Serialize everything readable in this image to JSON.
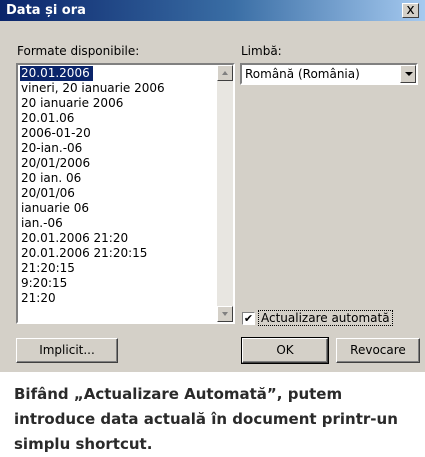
{
  "dialog": {
    "title": "Data și ora",
    "close_glyph": "x",
    "formats_label": "Formate disponibile:",
    "language_label": "Limbă:",
    "formats": [
      "20.01.2006",
      "vineri, 20 ianuarie 2006",
      "20 ianuarie 2006",
      "20.01.06",
      "2006-01-20",
      "20-ian.-06",
      "20/01/2006",
      "20 ian. 06",
      "20/01/06",
      "ianuarie 06",
      "ian.-06",
      "20.01.2006 21:20",
      "20.01.2006 21:20:15",
      "21:20:15",
      "9:20:15",
      "21:20"
    ],
    "selected_format_index": 0,
    "language_value": "Română (România)",
    "auto_update_label": "Actualizare automată",
    "auto_update_checked": true,
    "default_button": "Implicit...",
    "ok_button": "OK",
    "cancel_button": "Revocare"
  },
  "caption": {
    "text": "Bifând „Actualizare Automată”, putem introduce data actuală în document printr-un simplu shortcut."
  },
  "colors": {
    "title_bar": "#0a246a",
    "dialog_bg": "#d4d0c8",
    "selection": "#0a246a"
  }
}
